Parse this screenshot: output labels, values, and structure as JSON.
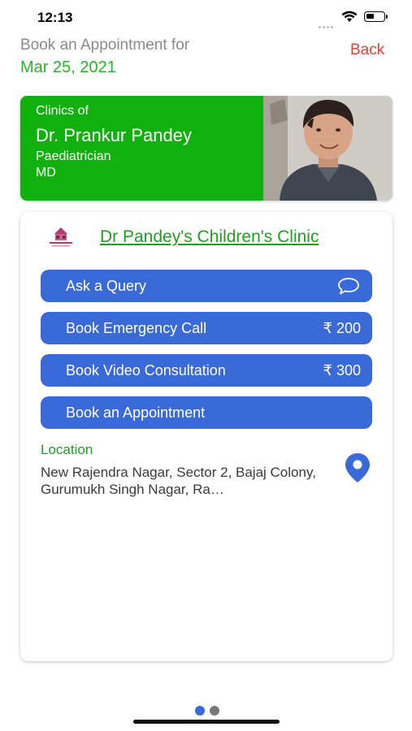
{
  "status_bar": {
    "time": "12:13"
  },
  "header": {
    "title": "Book an Appointment for",
    "date": "Mar 25, 2021",
    "back_label": "Back"
  },
  "doctor": {
    "clinics_of": "Clinics of",
    "name": "Dr. Prankur Pandey",
    "specialty": "Paediatrician",
    "degree": "MD"
  },
  "clinic": {
    "name": "Dr Pandey's Children's Clinic",
    "actions": [
      {
        "label": "Ask a Query",
        "icon": "chat-bubble-icon"
      },
      {
        "label": "Book Emergency Call",
        "price": "₹ 200"
      },
      {
        "label": "Book Video Consultation",
        "price": "₹ 300"
      },
      {
        "label": "Book an Appointment"
      }
    ],
    "location_label": "Location",
    "location_text": "New Rajendra Nagar, Sector 2, Bajaj Colony, Gurumukh Singh Nagar, Ra…"
  },
  "pager": {
    "page_count": 2,
    "current_page": 1
  },
  "colors": {
    "brand_green": "#10b10f",
    "text_green": "#1f9e20",
    "button_blue": "#3a6ad8",
    "back_red": "#ec3c2e",
    "dot_active": "#3a6ad8",
    "dot_inactive": "#777777"
  }
}
